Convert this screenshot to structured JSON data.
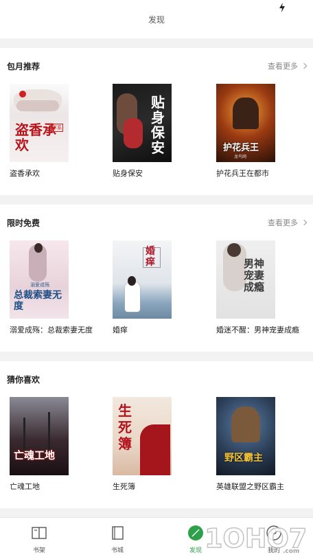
{
  "header": {
    "title": "发现"
  },
  "sections": [
    {
      "title": "包月推荐",
      "more": "查看更多",
      "books": [
        {
          "title": "盗香承欢",
          "cover_text": "盗香承欢",
          "cover_tag": "军系"
        },
        {
          "title": "贴身保安",
          "cover_text": "贴身保安"
        },
        {
          "title": "护花兵王在都市",
          "cover_text": "护花兵王",
          "cover_tag": "龙鸟网"
        }
      ]
    },
    {
      "title": "限时免费",
      "more": "查看更多",
      "books": [
        {
          "title": "溺爱成殇：总裁索妻无度",
          "cover_text": "总裁索妻无度",
          "cover_tag": "溺爱成殇"
        },
        {
          "title": "婚痒",
          "cover_text": "婚痒"
        },
        {
          "title": "婚迷不醒：男神宠妻成瘾",
          "cover_text": "男神宠妻成瘾"
        }
      ]
    },
    {
      "title": "猜你喜欢",
      "books": [
        {
          "title": "亡魂工地",
          "cover_text": "亡魂工地"
        },
        {
          "title": "生死簿",
          "cover_text": "生死簿"
        },
        {
          "title": "英雄联盟之野区霸主",
          "cover_text": "野区霸主"
        }
      ]
    }
  ],
  "tabbar": {
    "items": [
      {
        "label": "书架",
        "icon": "bookshelf-icon"
      },
      {
        "label": "书城",
        "icon": "bookstore-icon"
      },
      {
        "label": "发现",
        "icon": "discover-icon",
        "active": true
      },
      {
        "label": "我的",
        "icon": "profile-icon"
      }
    ]
  },
  "colors": {
    "accent": "#2ea04a",
    "background": "#f2f2f2"
  },
  "watermark": "1OHO7.com"
}
